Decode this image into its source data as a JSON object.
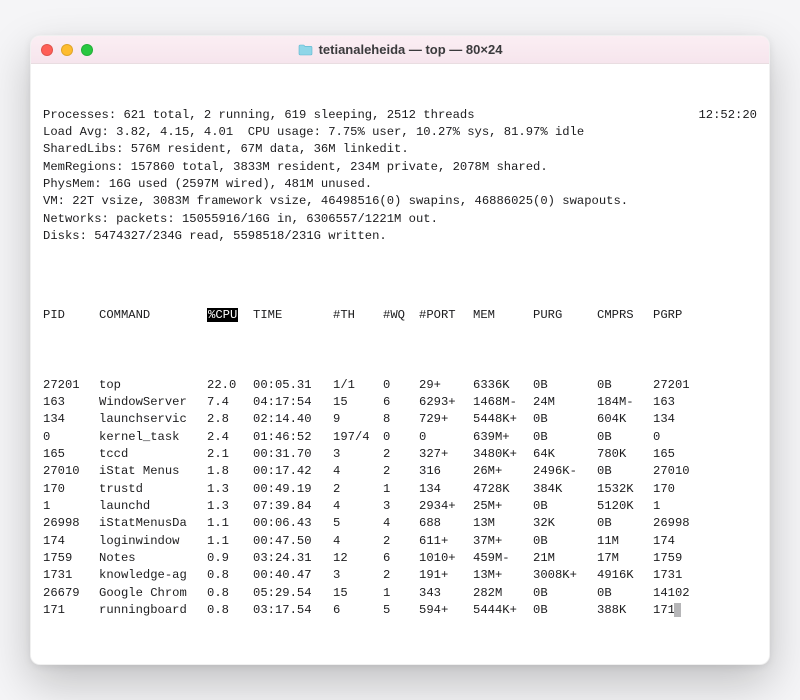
{
  "window": {
    "folder_color": "#6ec8e0",
    "title": "tetianaleheida — top — 80×24"
  },
  "clock": "12:52:20",
  "summary": [
    "Processes: 621 total, 2 running, 619 sleeping, 2512 threads",
    "Load Avg: 3.82, 4.15, 4.01  CPU usage: 7.75% user, 10.27% sys, 81.97% idle",
    "SharedLibs: 576M resident, 67M data, 36M linkedit.",
    "MemRegions: 157860 total, 3833M resident, 234M private, 2078M shared.",
    "PhysMem: 16G used (2597M wired), 481M unused.",
    "VM: 22T vsize, 3083M framework vsize, 46498516(0) swapins, 46886025(0) swapouts.",
    "Networks: packets: 15055916/16G in, 6306557/1221M out.",
    "Disks: 5474327/234G read, 5598518/231G written."
  ],
  "headers": {
    "pid": "PID",
    "command": "COMMAND",
    "cpu": "%CPU",
    "time": "TIME",
    "th": "#TH",
    "wq": "#WQ",
    "port": "#PORT",
    "mem": "MEM",
    "purg": "PURG",
    "cmprs": "CMPRS",
    "pgrp": "PGRP"
  },
  "rows": [
    {
      "pid": "27201",
      "cmd": "top",
      "cpu": "22.0",
      "time": "00:05.31",
      "th": "1/1",
      "wq": "0",
      "port": "29+",
      "mem": "6336K",
      "purg": "0B",
      "cmprs": "0B",
      "pgrp": "27201"
    },
    {
      "pid": "163",
      "cmd": "WindowServer",
      "cpu": "7.4",
      "time": "04:17:54",
      "th": "15",
      "wq": "6",
      "port": "6293+",
      "mem": "1468M-",
      "purg": "24M",
      "cmprs": "184M-",
      "pgrp": "163"
    },
    {
      "pid": "134",
      "cmd": "launchservic",
      "cpu": "2.8",
      "time": "02:14.40",
      "th": "9",
      "wq": "8",
      "port": "729+",
      "mem": "5448K+",
      "purg": "0B",
      "cmprs": "604K",
      "pgrp": "134"
    },
    {
      "pid": "0",
      "cmd": "kernel_task",
      "cpu": "2.4",
      "time": "01:46:52",
      "th": "197/4",
      "wq": "0",
      "port": "0",
      "mem": "639M+",
      "purg": "0B",
      "cmprs": "0B",
      "pgrp": "0"
    },
    {
      "pid": "165",
      "cmd": "tccd",
      "cpu": "2.1",
      "time": "00:31.70",
      "th": "3",
      "wq": "2",
      "port": "327+",
      "mem": "3480K+",
      "purg": "64K",
      "cmprs": "780K",
      "pgrp": "165"
    },
    {
      "pid": "27010",
      "cmd": "iStat Menus",
      "cpu": "1.8",
      "time": "00:17.42",
      "th": "4",
      "wq": "2",
      "port": "316",
      "mem": "26M+",
      "purg": "2496K-",
      "cmprs": "0B",
      "pgrp": "27010"
    },
    {
      "pid": "170",
      "cmd": "trustd",
      "cpu": "1.3",
      "time": "00:49.19",
      "th": "2",
      "wq": "1",
      "port": "134",
      "mem": "4728K",
      "purg": "384K",
      "cmprs": "1532K",
      "pgrp": "170"
    },
    {
      "pid": "1",
      "cmd": "launchd",
      "cpu": "1.3",
      "time": "07:39.84",
      "th": "4",
      "wq": "3",
      "port": "2934+",
      "mem": "25M+",
      "purg": "0B",
      "cmprs": "5120K",
      "pgrp": "1"
    },
    {
      "pid": "26998",
      "cmd": "iStatMenusDa",
      "cpu": "1.1",
      "time": "00:06.43",
      "th": "5",
      "wq": "4",
      "port": "688",
      "mem": "13M",
      "purg": "32K",
      "cmprs": "0B",
      "pgrp": "26998"
    },
    {
      "pid": "174",
      "cmd": "loginwindow",
      "cpu": "1.1",
      "time": "00:47.50",
      "th": "4",
      "wq": "2",
      "port": "611+",
      "mem": "37M+",
      "purg": "0B",
      "cmprs": "11M",
      "pgrp": "174"
    },
    {
      "pid": "1759",
      "cmd": "Notes",
      "cpu": "0.9",
      "time": "03:24.31",
      "th": "12",
      "wq": "6",
      "port": "1010+",
      "mem": "459M-",
      "purg": "21M",
      "cmprs": "17M",
      "pgrp": "1759"
    },
    {
      "pid": "1731",
      "cmd": "knowledge-ag",
      "cpu": "0.8",
      "time": "00:40.47",
      "th": "3",
      "wq": "2",
      "port": "191+",
      "mem": "13M+",
      "purg": "3008K+",
      "cmprs": "4916K",
      "pgrp": "1731"
    },
    {
      "pid": "26679",
      "cmd": "Google Chrom",
      "cpu": "0.8",
      "time": "05:29.54",
      "th": "15",
      "wq": "1",
      "port": "343",
      "mem": "282M",
      "purg": "0B",
      "cmprs": "0B",
      "pgrp": "14102"
    },
    {
      "pid": "171",
      "cmd": "runningboard",
      "cpu": "0.8",
      "time": "03:17.54",
      "th": "6",
      "wq": "5",
      "port": "594+",
      "mem": "5444K+",
      "purg": "0B",
      "cmprs": "388K",
      "pgrp": "171"
    }
  ]
}
